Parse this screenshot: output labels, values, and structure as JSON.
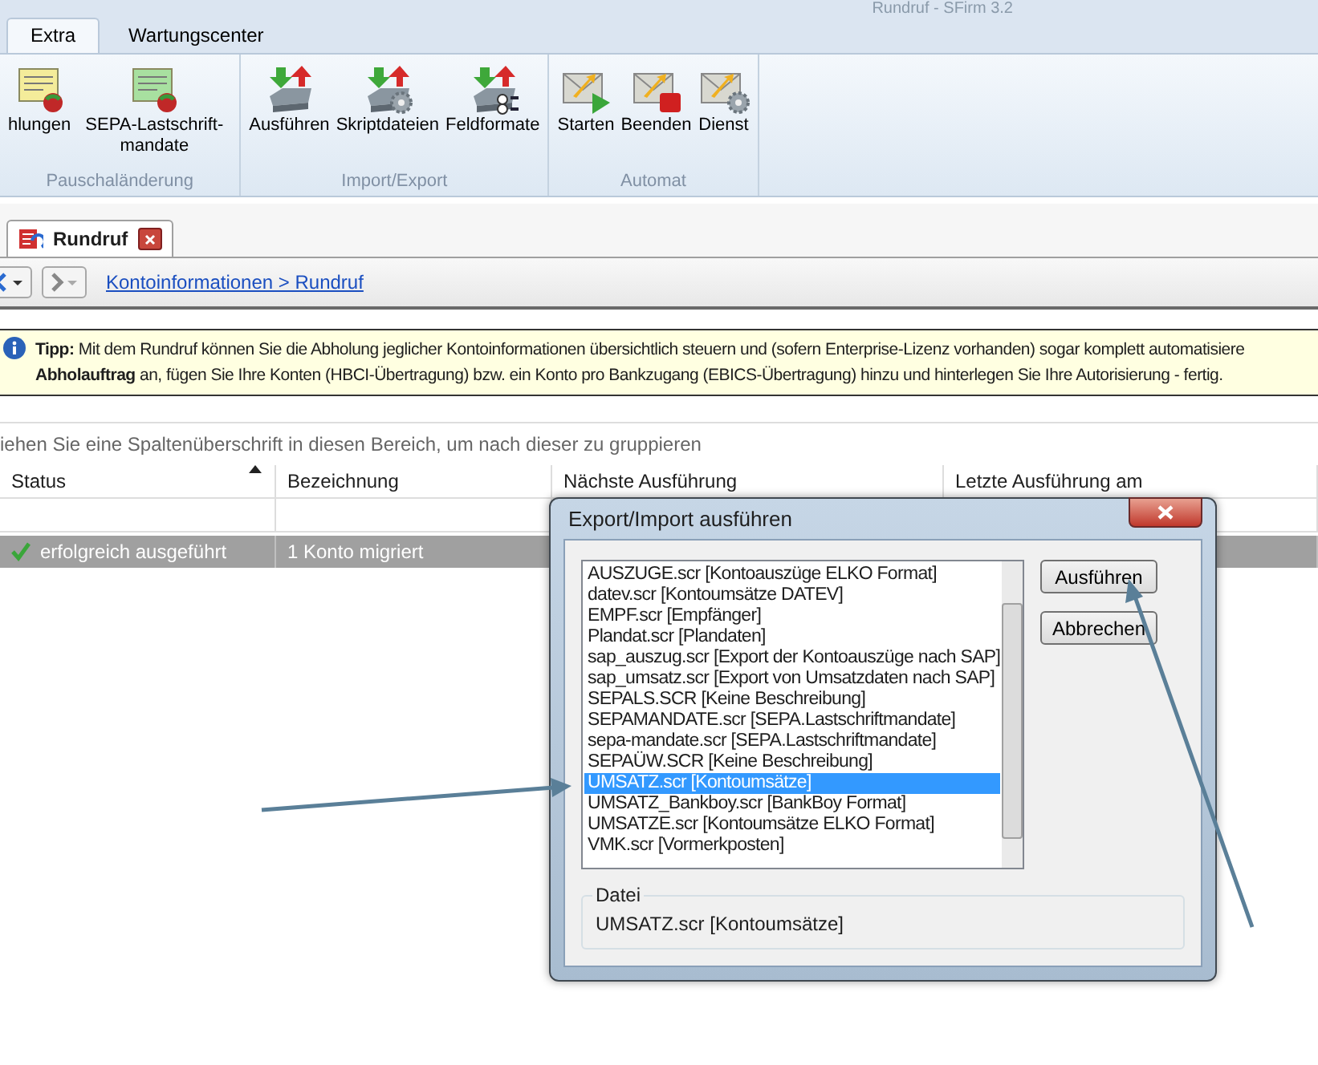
{
  "window": {
    "title": "Rundruf - SFirm 3.2"
  },
  "ribbon": {
    "tabs": [
      {
        "label": "Extra",
        "selected": true
      },
      {
        "label": "Wartungscenter",
        "selected": false
      }
    ],
    "groups": [
      {
        "label": "Pauschaländerung",
        "items": [
          {
            "label": "hlungen",
            "kind": "card-yellow"
          },
          {
            "label": "SEPA-Lastschrift-mandate",
            "kind": "card-green"
          }
        ]
      },
      {
        "label": "Import/Export",
        "items": [
          {
            "label": "Ausführen",
            "kind": "drive"
          },
          {
            "label": "Skriptdateien",
            "kind": "drive-gear"
          },
          {
            "label": "Feldformate",
            "kind": "drive-format"
          }
        ]
      },
      {
        "label": "Automat",
        "items": [
          {
            "label": "Starten",
            "kind": "mail-play"
          },
          {
            "label": "Beenden",
            "kind": "mail-stop"
          },
          {
            "label": "Dienst",
            "kind": "mail-gear"
          }
        ]
      }
    ]
  },
  "doc_tabs": [
    {
      "label": "Rundruf"
    }
  ],
  "nav": {
    "breadcrumb": "Kontoinformationen > Rundruf"
  },
  "tip": {
    "lines": [
      "**Tipp:** Mit dem Rundruf können Sie die Abholung jeglicher Kontoinformationen übersichtlich steuern und (sofern Enterprise-Lizenz vorhanden) sogar komplett automatisiere",
      "**Abholauftrag** an, fügen Sie Ihre Konten (HBCI-Übertragung) bzw. ein Konto pro Bankzugang (EBICS-Übertragung) hinzu und hinterlegen Sie Ihre Autorisierung - fertig."
    ]
  },
  "group_hint": "iehen Sie eine Spaltenüberschrift in diesen Bereich, um nach dieser zu gruppieren",
  "grid": {
    "columns": [
      {
        "label": "Status",
        "sorted": true
      },
      {
        "label": "Bezeichnung",
        "sorted": false
      },
      {
        "label": "Nächste Ausführung",
        "sorted": false
      },
      {
        "label": "Letzte Ausführung am",
        "sorted": false
      }
    ],
    "rows": [
      {
        "status": "erfolgreich ausgeführt",
        "name": "1 Konto migriert",
        "ok": true,
        "selected": true
      }
    ]
  },
  "dialog": {
    "title": "Export/Import ausführen",
    "items": [
      {
        "label": "AUSZUGE.scr [Kontoauszüge ELKO Format]",
        "selected": false
      },
      {
        "label": "datev.scr [Kontoumsätze DATEV]",
        "selected": false
      },
      {
        "label": "EMPF.scr [Empfänger]",
        "selected": false
      },
      {
        "label": "Plandat.scr [Plandaten]",
        "selected": false
      },
      {
        "label": "sap_auszug.scr [Export der Kontoauszüge nach SAP]",
        "selected": false
      },
      {
        "label": "sap_umsatz.scr [Export von Umsatzdaten nach SAP]",
        "selected": false
      },
      {
        "label": "SEPALS.SCR [Keine Beschreibung]",
        "selected": false
      },
      {
        "label": "SEPAMANDATE.scr [SEPA.Lastschriftmandate]",
        "selected": false
      },
      {
        "label": "sepa-mandate.scr [SEPA.Lastschriftmandate]",
        "selected": false
      },
      {
        "label": "SEPAÜW.SCR [Keine Beschreibung]",
        "selected": false
      },
      {
        "label": "UMSATZ.scr [Kontoumsätze]",
        "selected": true
      },
      {
        "label": "UMSATZ_Bankboy.scr [BankBoy Format]",
        "selected": false
      },
      {
        "label": "UMSATZE.scr [Kontoumsätze ELKO Format]",
        "selected": false
      },
      {
        "label": "VMK.scr [Vormerkposten]",
        "selected": false
      }
    ],
    "buttons": [
      "Ausführen",
      "Abbrechen"
    ],
    "file_group": {
      "label": "Datei",
      "value": "UMSATZ.scr [Kontoumsätze]"
    }
  }
}
